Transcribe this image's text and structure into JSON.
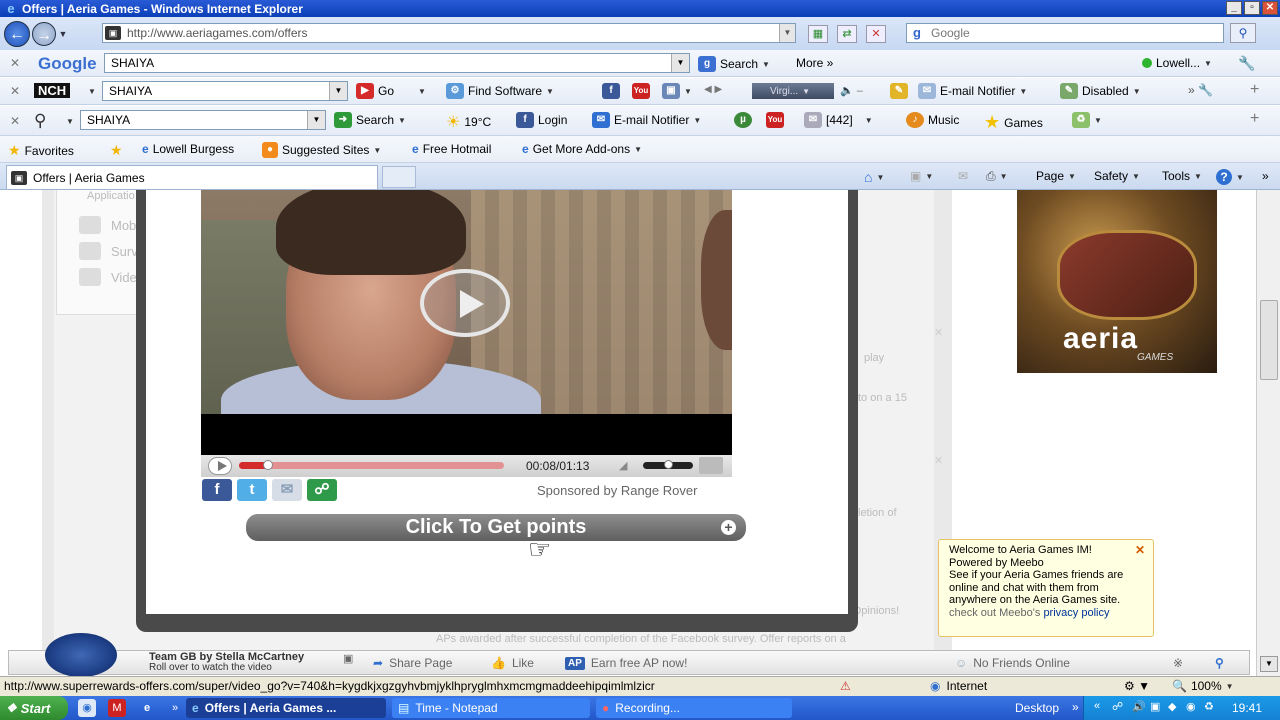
{
  "window": {
    "title": "Offers | Aeria Games - Windows Internet Explorer",
    "controls": [
      "_",
      "▫",
      "✕"
    ]
  },
  "address_bar": {
    "url": "http://www.aeriagames.com/offers",
    "search_placeholder": "Google"
  },
  "google_toolbar": {
    "logo": "Google",
    "query": "SHAIYA",
    "search_label": "Search",
    "more_label": "More »",
    "user_label": "Lowell..."
  },
  "nch_toolbar": {
    "logo": "NCH",
    "query": "SHAIYA",
    "go_label": "Go",
    "find_software_label": "Find Software",
    "radio_label": "Virgi...",
    "email_notifier_label": "E-mail Notifier",
    "disabled_label": "Disabled"
  },
  "search_toolbar": {
    "query": "SHAIYA",
    "search_label": "Search",
    "weather": "19°C",
    "login_label": "Login",
    "email_notifier_label": "E-mail Notifier",
    "count_badge": "[442]",
    "music_label": "Music",
    "games_label": "Games"
  },
  "favorites_bar": {
    "favorites_label": "Favorites",
    "items": [
      "Lowell Burgess",
      "Suggested Sites",
      "Free Hotmail",
      "Get More Add-ons"
    ]
  },
  "tab_bar": {
    "active_tab": "Offers | Aeria Games",
    "commands": [
      "Page",
      "Safety",
      "Tools"
    ]
  },
  "video_player": {
    "time": "00:08/01:13",
    "progress_fraction": 0.11,
    "volume_fraction": 0.5,
    "sponsored_text": "Sponsored by Range Rover",
    "cta_label": "Click To Get points"
  },
  "background_page": {
    "side_items": [
      "Mob",
      "Surv",
      "Vide"
    ],
    "header_fragment": "Applicatio",
    "fragments": [
      "play",
      "to on a 15",
      "letion of",
      "r Opinions!",
      "APs awarded after successful completion of the Facebook survey. Offer reports on a"
    ]
  },
  "ad": {
    "logo": "aeria",
    "sublogo": "GAMES"
  },
  "meebo_tooltip": {
    "line1": "Welcome to Aeria Games IM!",
    "line2": "Powered by Meebo",
    "line3": "See if your Aeria Games friends are online and chat with them from anywhere on the Aeria Games site.",
    "line4_prefix": "check out Meebo's",
    "line4_link": "privacy policy"
  },
  "meebo_bar": {
    "promo_title": "Team GB by Stella McCartney",
    "promo_subtitle": "Roll over to watch the video",
    "share_page": "Share Page",
    "like": "Like",
    "earn_ap": "Earn free AP now!",
    "ap_badge": "AP",
    "friends_status": "No Friends Online"
  },
  "status_bar": {
    "url": "http://www.superrewards-offers.com/super/video_go?v=740&h=kygdkjxgzgyhvbmjyklhpryglmhxmcmgmaddeehipqimlmlzicr",
    "zone": "Internet",
    "zoom": "100%"
  },
  "taskbar": {
    "start_label": "Start",
    "tasks": [
      "Offers | Aeria Games ...",
      "Time - Notepad",
      "Recording..."
    ],
    "desktop_label": "Desktop",
    "clock": "19:41"
  }
}
